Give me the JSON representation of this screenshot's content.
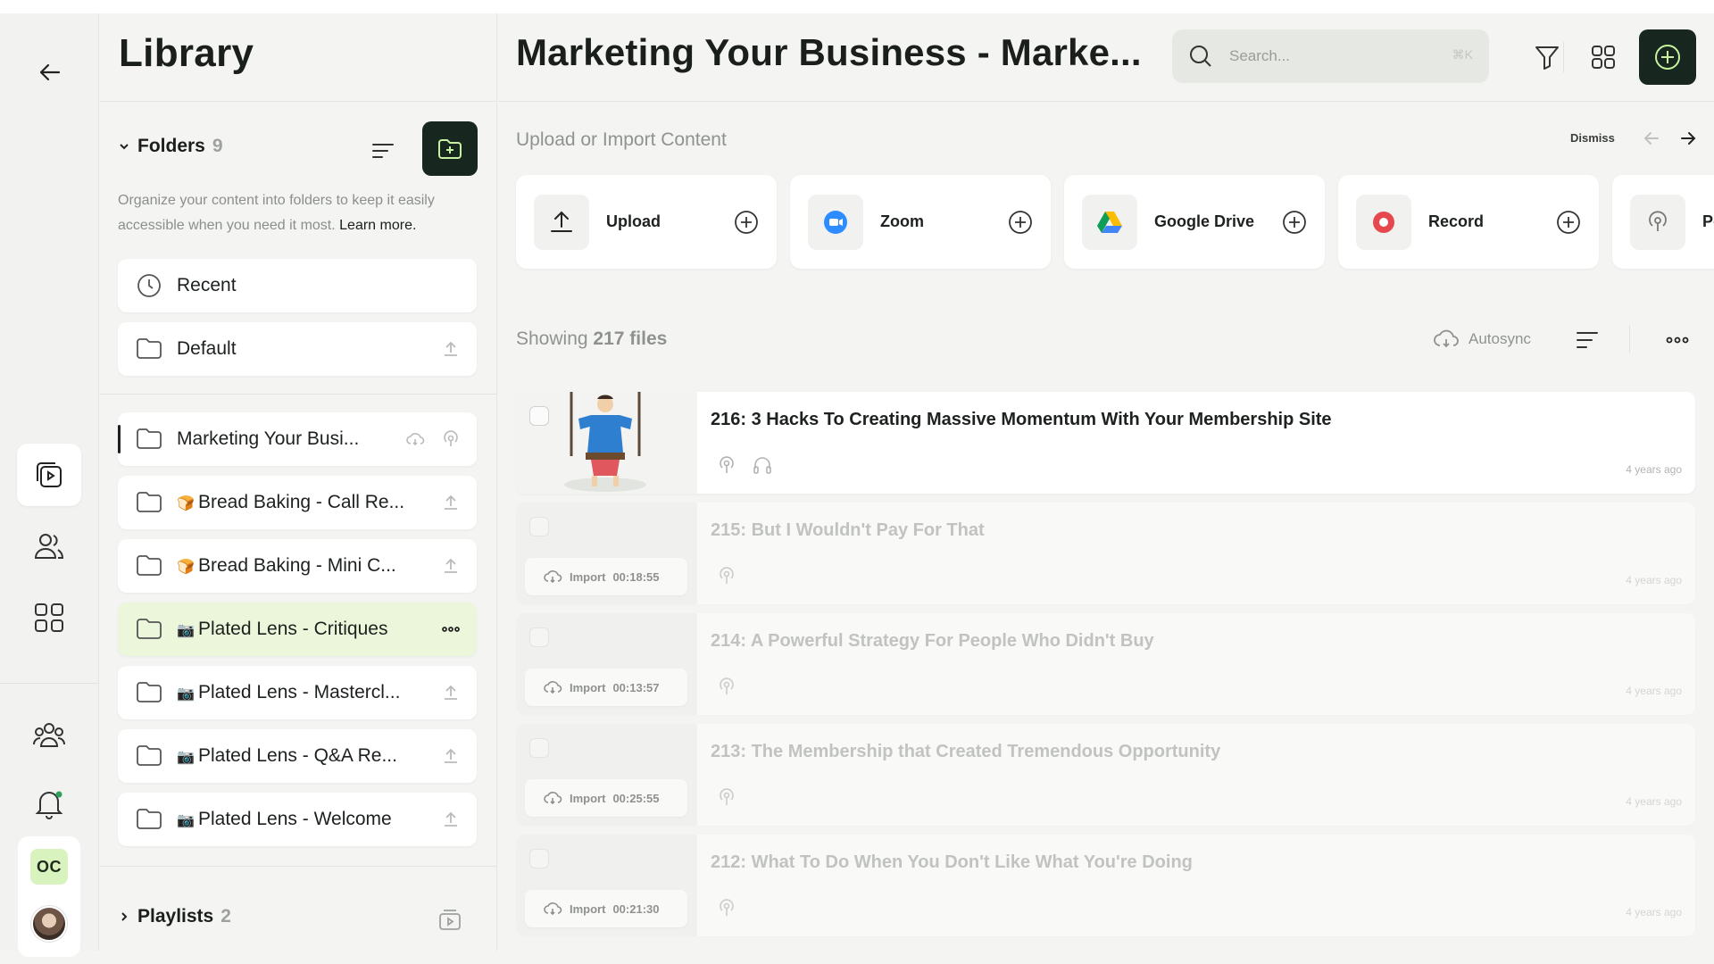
{
  "library": {
    "title": "Library",
    "folders_label": "Folders",
    "folders_count": "9",
    "description": "Organize your content into folders to keep it easily accessible when you need it most.",
    "learn_more": "Learn more.",
    "pinned": [
      {
        "label": "Recent",
        "icon": "clock-icon"
      },
      {
        "label": "Default",
        "icon": "folder-icon"
      }
    ],
    "folders": [
      {
        "emoji": "",
        "label": "Marketing Your Busi...",
        "right_icons": [
          "cloud-sync-icon",
          "podcast-icon"
        ]
      },
      {
        "emoji": "🍞",
        "label": "Bread Baking - Call Re...",
        "right_icons": [
          "upload-icon"
        ]
      },
      {
        "emoji": "🍞",
        "label": "Bread Baking - Mini C...",
        "right_icons": [
          "upload-icon"
        ]
      },
      {
        "emoji": "📷",
        "label": "Plated Lens - Critiques",
        "right_icons": [
          "more-icon"
        ]
      },
      {
        "emoji": "📷",
        "label": "Plated Lens - Mastercl...",
        "right_icons": [
          "upload-icon"
        ]
      },
      {
        "emoji": "📷",
        "label": "Plated Lens - Q&A Re...",
        "right_icons": [
          "upload-icon"
        ]
      },
      {
        "emoji": "📷",
        "label": "Plated Lens - Welcome",
        "right_icons": [
          "upload-icon"
        ]
      }
    ],
    "playlists_label": "Playlists",
    "playlists_count": "2"
  },
  "rail": {
    "user_initials": "OC"
  },
  "main": {
    "title": "Marketing Your Business - Marke...",
    "search_placeholder": "Search...",
    "search_shortcut": "⌘K",
    "upload_title": "Upload or Import Content",
    "dismiss_label": "Dismiss",
    "sources": [
      {
        "label": "Upload",
        "icon": "upload-icon"
      },
      {
        "label": "Zoom",
        "icon": "zoom-icon"
      },
      {
        "label": "Google Drive",
        "icon": "google-drive-icon"
      },
      {
        "label": "Record",
        "icon": "record-icon"
      },
      {
        "label": "Po",
        "icon": "podcast-icon"
      }
    ],
    "showing_prefix": "Showing",
    "showing_count": "217 files",
    "autosync_label": "Autosync",
    "files": [
      {
        "title": "216: 3 Hacks To Creating Massive Momentum With Your Membership Site",
        "time": "4 years ago",
        "import_label": "",
        "duration": ""
      },
      {
        "title": "215: But I Wouldn't Pay For That",
        "time": "4 years ago",
        "import_label": "Import",
        "duration": "00:18:55"
      },
      {
        "title": "214: A Powerful Strategy For People Who Didn't Buy",
        "time": "4 years ago",
        "import_label": "Import",
        "duration": "00:13:57"
      },
      {
        "title": "213: The Membership that Created Tremendous Opportunity",
        "time": "4 years ago",
        "import_label": "Import",
        "duration": "00:25:55"
      },
      {
        "title": "212: What To Do When You Don't Like What You're Doing",
        "time": "4 years ago",
        "import_label": "Import",
        "duration": "00:21:30"
      }
    ]
  },
  "colors": {
    "accent_dark": "#17261f",
    "selected_folder_bg": "#ecf6db",
    "initials_bg": "#d9f3bf",
    "record_red": "#e5484d",
    "zoom_blue": "#2d8cff"
  }
}
